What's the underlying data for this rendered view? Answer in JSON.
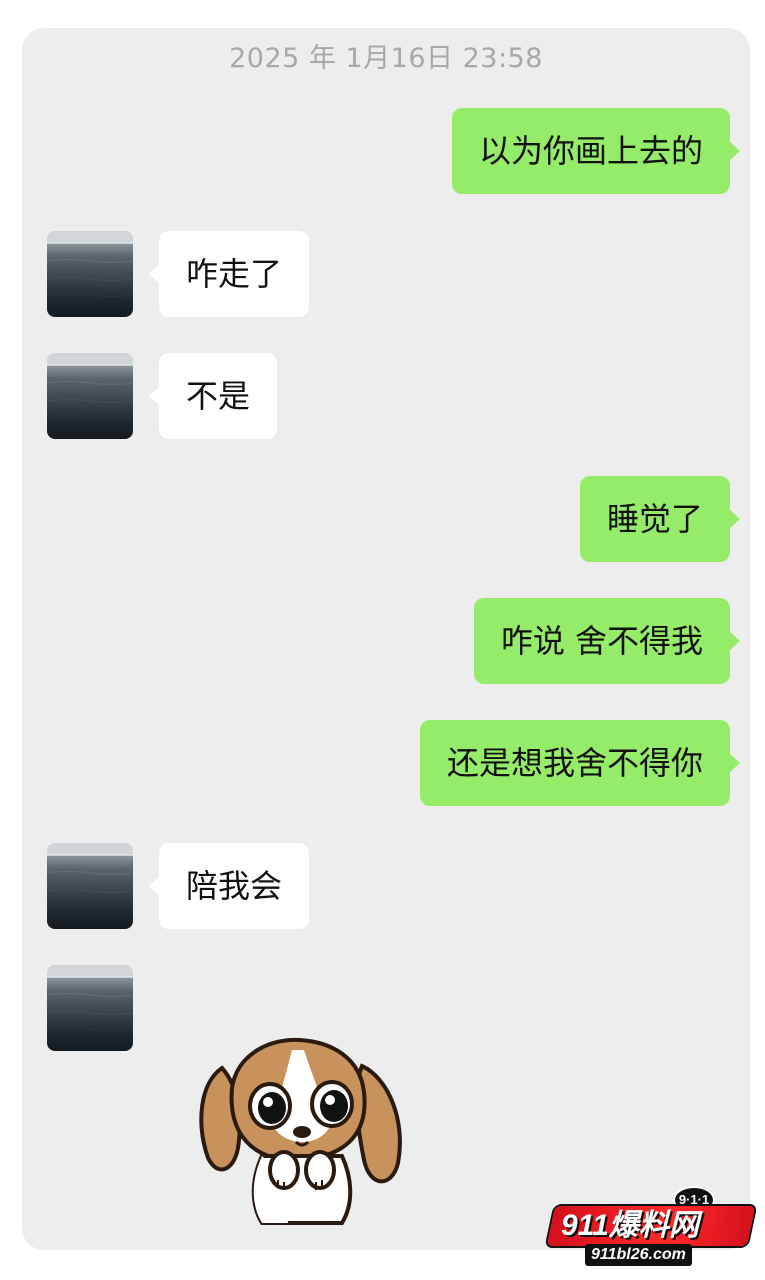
{
  "chat": {
    "timestamp": "2025 年 1月16日 23:58",
    "messages": [
      {
        "side": "sent",
        "text": "以为你画上去的"
      },
      {
        "side": "received",
        "text": "咋走了"
      },
      {
        "side": "received",
        "text": "不是"
      },
      {
        "side": "sent",
        "text": "睡觉了"
      },
      {
        "side": "sent",
        "text": "咋说 舍不得我"
      },
      {
        "side": "sent",
        "text": "还是想我舍不得你"
      },
      {
        "side": "received",
        "text": "陪我会"
      },
      {
        "side": "received",
        "sticker": "crying-puppy-sticker"
      }
    ]
  },
  "colors": {
    "sent_bubble": "#95ec69",
    "received_bubble": "#ffffff",
    "chat_background": "#ededed",
    "timestamp_text": "#a8a8a8"
  },
  "watermark": {
    "badge": "9·1·1",
    "title": "911爆料网",
    "url": "911bl26.com"
  }
}
